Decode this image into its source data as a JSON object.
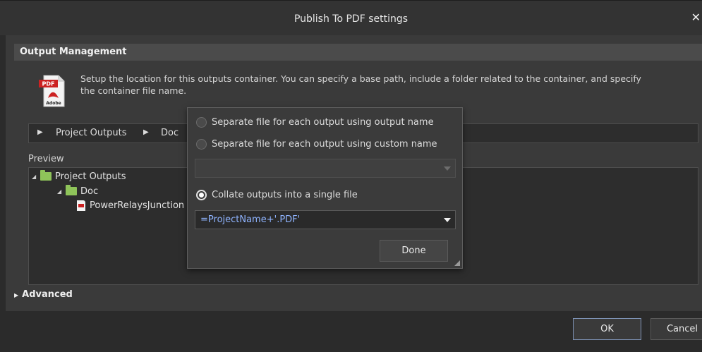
{
  "dialog": {
    "title": "Publish To PDF settings",
    "close_glyph": "✕"
  },
  "output_management": {
    "header": "Output Management",
    "description": "Setup the location for this outputs container. You can specify a base path, include a folder related to the container, and specify the container file name.",
    "icon": "pdf-adobe-icon",
    "icon_text": {
      "badge": "PDF",
      "brand": "Adobe"
    }
  },
  "path": {
    "crumbs": [
      "Project Outputs",
      "Doc"
    ]
  },
  "preview": {
    "label": "Preview",
    "root": "Project Outputs",
    "child": "Doc",
    "file": "PowerRelaysJunction"
  },
  "advanced": {
    "label": "Advanced"
  },
  "popup": {
    "options": [
      "Separate file for each output using output name",
      "Separate file for each output using custom name",
      "Collate outputs into a single file"
    ],
    "selected_index": 2,
    "custom_name_value": "",
    "filename_expression": "=ProjectName+'.PDF'",
    "done_label": "Done"
  },
  "buttons": {
    "ok": "OK",
    "cancel": "Cancel"
  },
  "colors": {
    "accent": "#8fb4ff",
    "folder": "#8fc45a",
    "pdf_red": "#cc2222"
  }
}
